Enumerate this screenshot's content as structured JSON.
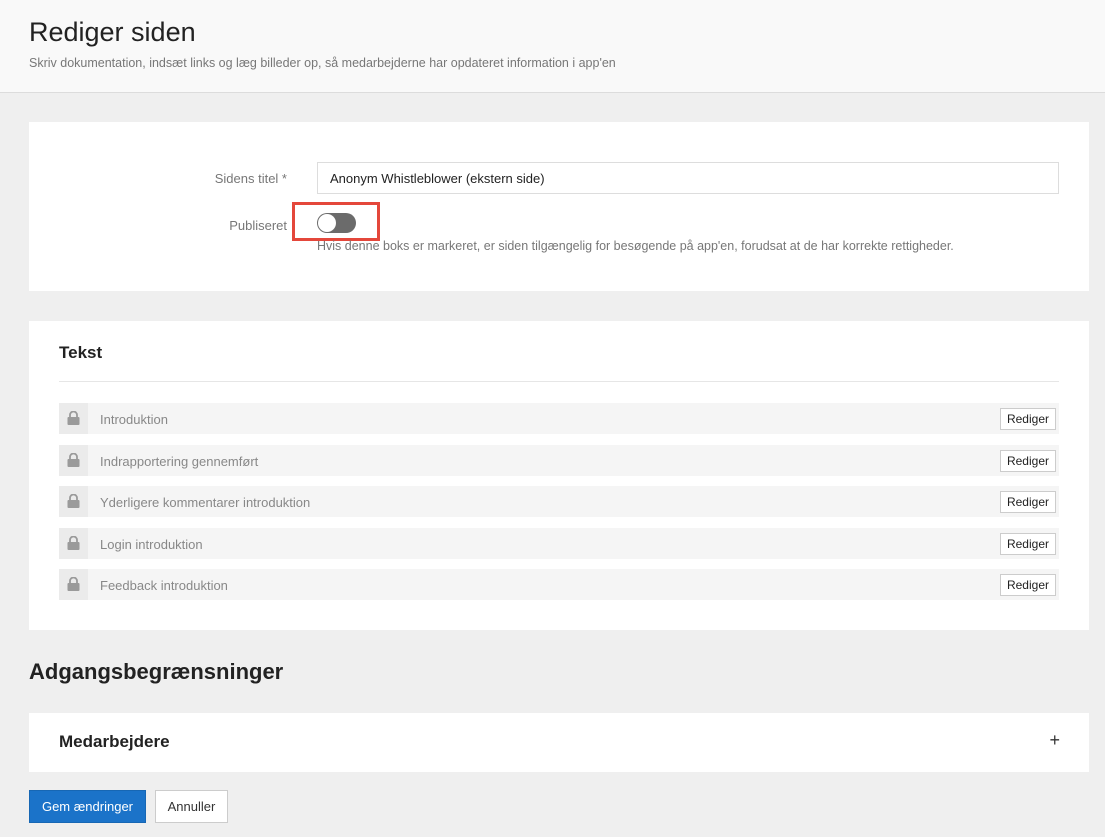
{
  "header": {
    "title": "Rediger siden",
    "subtitle": "Skriv dokumentation, indsæt links og læg billeder op, så medarbejderne har opdateret information i app'en"
  },
  "settings": {
    "title_label": "Sidens titel *",
    "title_value": "Anonym Whistleblower (ekstern side)",
    "published_label": "Publiseret",
    "published": false,
    "published_help": "Hvis denne boks er markeret, er siden tilgængelig for besøgende på app'en, forudsat at de har korrekte rettigheder."
  },
  "text_section": {
    "title": "Tekst",
    "edit_label": "Rediger",
    "items": [
      {
        "label": "Introduktion"
      },
      {
        "label": "Indrapportering gennemført"
      },
      {
        "label": "Yderligere kommentarer introduktion"
      },
      {
        "label": "Login introduktion"
      },
      {
        "label": "Feedback introduktion"
      }
    ]
  },
  "access": {
    "title": "Adgangsbegrænsninger",
    "employees_title": "Medarbejdere",
    "add_symbol": "+"
  },
  "actions": {
    "save_label": "Gem ændringer",
    "cancel_label": "Annuller"
  },
  "colors": {
    "primary": "#1b73c9",
    "highlight": "#e4473b",
    "toggle_off": "#6b6b6b"
  },
  "icons": {
    "lock": "lock-icon",
    "add": "plus-icon"
  }
}
